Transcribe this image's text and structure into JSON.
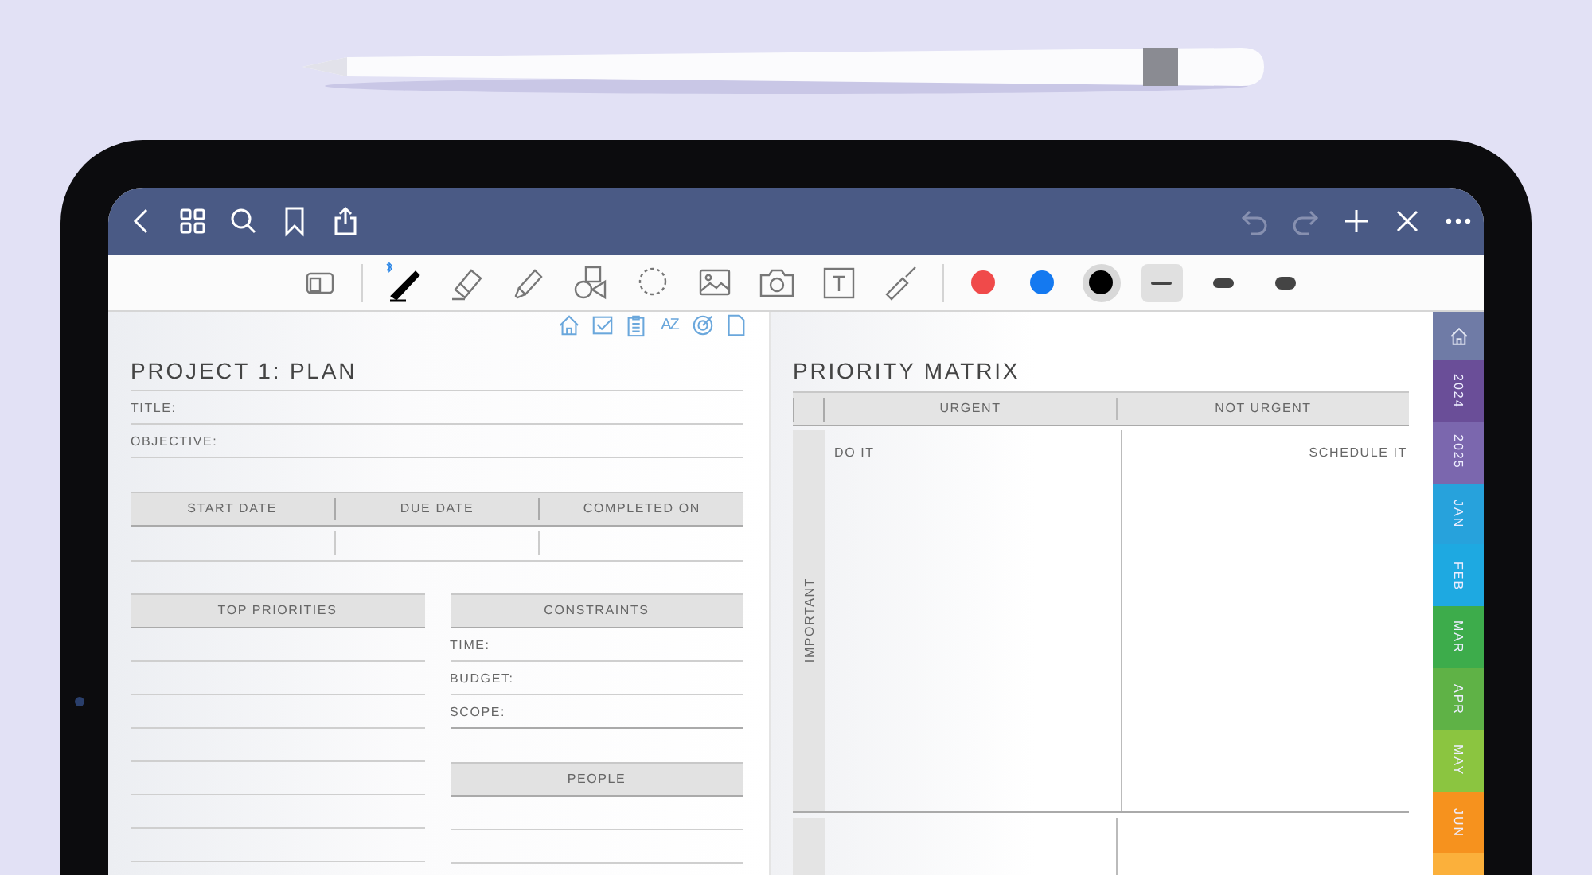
{
  "top_bar": {
    "left_buttons": [
      {
        "kind": "back"
      },
      {
        "kind": "grid"
      },
      {
        "kind": "search"
      },
      {
        "kind": "bookmark"
      },
      {
        "kind": "share"
      }
    ],
    "right_buttons": [
      {
        "kind": "undo",
        "disabled": true
      },
      {
        "kind": "redo",
        "disabled": true
      },
      {
        "kind": "add",
        "disabled": false
      },
      {
        "kind": "close",
        "disabled": false
      },
      {
        "kind": "more",
        "disabled": false
      }
    ]
  },
  "toolbar": {
    "tools": [
      {
        "kind": "layout",
        "selected": false
      },
      {
        "kind": "pen",
        "selected": true
      },
      {
        "kind": "eraser",
        "selected": false
      },
      {
        "kind": "highlighter",
        "selected": false
      },
      {
        "kind": "shapes",
        "selected": false
      },
      {
        "kind": "lasso",
        "selected": false
      },
      {
        "kind": "image",
        "selected": false
      },
      {
        "kind": "camera",
        "selected": false
      },
      {
        "kind": "textbox",
        "selected": false
      },
      {
        "kind": "laser",
        "selected": false
      }
    ],
    "colors": [
      {
        "color": "#f04a4a",
        "selected": false
      },
      {
        "color": "#1479f0",
        "selected": false
      },
      {
        "color": "#000000",
        "selected": true
      }
    ],
    "thickness": [
      {
        "kind": "thin",
        "selected": true
      },
      {
        "kind": "medium",
        "selected": false
      },
      {
        "kind": "thick",
        "selected": false
      }
    ]
  },
  "left_page": {
    "nav_icons": [
      {
        "kind": "home"
      },
      {
        "kind": "check"
      },
      {
        "kind": "clipboard"
      },
      {
        "kind": "sort",
        "label": "AZ"
      },
      {
        "kind": "target"
      },
      {
        "kind": "page"
      }
    ],
    "title": "PROJECT 1: PLAN",
    "fields": [
      "TITLE:",
      "OBJECTIVE:"
    ],
    "dates": {
      "columns": [
        "START DATE",
        "DUE DATE",
        "COMPLETED ON"
      ]
    },
    "top_priorities": {
      "header": "TOP PRIORITIES"
    },
    "constraints": {
      "header": "CONSTRAINTS",
      "fields": [
        "TIME:",
        "BUDGET:",
        "SCOPE:"
      ]
    },
    "people": {
      "header": "PEOPLE"
    }
  },
  "right_page": {
    "title": "PRIORITY MATRIX",
    "columns": [
      "URGENT",
      "NOT URGENT"
    ],
    "row_label": "IMPORTANT",
    "cells": [
      "DO IT",
      "SCHEDULE IT"
    ]
  },
  "side_tabs": [
    {
      "kind": "home",
      "color": "#6f7ba6"
    },
    {
      "kind": "text",
      "label": "2024",
      "color": "#6a4e98"
    },
    {
      "kind": "text",
      "label": "2025",
      "color": "#7b67ae"
    },
    {
      "kind": "text",
      "label": "JAN",
      "color": "#27a2dc"
    },
    {
      "kind": "text",
      "label": "FEB",
      "color": "#1ea9e1"
    },
    {
      "kind": "text",
      "label": "MAR",
      "color": "#3dac4b"
    },
    {
      "kind": "text",
      "label": "APR",
      "color": "#5fb246"
    },
    {
      "kind": "text",
      "label": "MAY",
      "color": "#8bc540"
    },
    {
      "kind": "text",
      "label": "JUN",
      "color": "#f6921e"
    },
    {
      "kind": "blank",
      "color": "#fbb03b"
    }
  ]
}
